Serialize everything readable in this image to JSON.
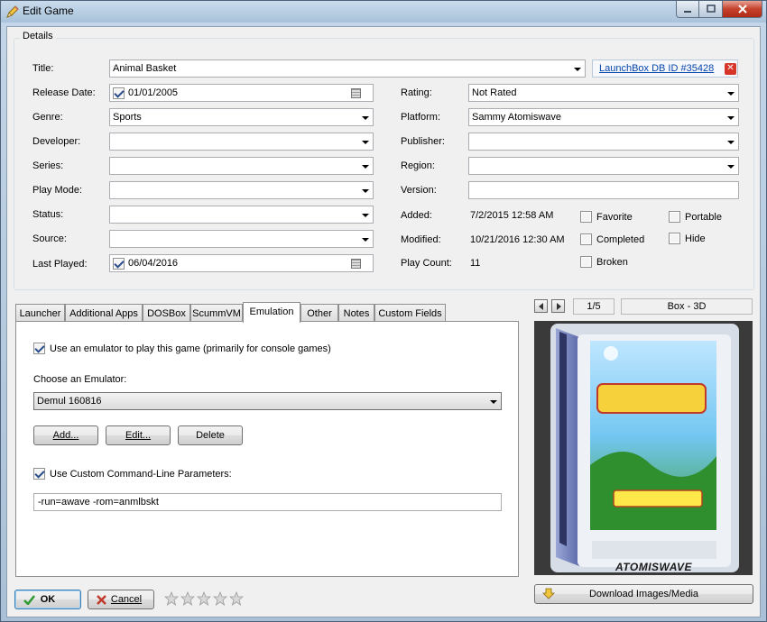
{
  "window": {
    "title": "Edit Game"
  },
  "details": {
    "legend": "Details",
    "labels": {
      "title": "Title:",
      "release_date": "Release Date:",
      "genre": "Genre:",
      "developer": "Developer:",
      "series": "Series:",
      "play_mode": "Play Mode:",
      "status": "Status:",
      "source": "Source:",
      "last_played": "Last Played:",
      "rating": "Rating:",
      "platform": "Platform:",
      "publisher": "Publisher:",
      "region": "Region:",
      "version": "Version:",
      "added": "Added:",
      "modified": "Modified:",
      "play_count": "Play Count:"
    },
    "values": {
      "title": "Animal Basket",
      "release_date": "01/01/2005",
      "genre": "Sports",
      "developer": "",
      "series": "",
      "play_mode": "",
      "status": "",
      "source": "",
      "last_played": "06/04/2016",
      "rating": "Not Rated",
      "platform": "Sammy Atomiswave",
      "publisher": "",
      "region": "",
      "version": "",
      "added": "7/2/2015 12:58 AM",
      "modified": "10/21/2016 12:30 AM",
      "play_count": "11"
    },
    "db_link": "LaunchBox DB ID #35428",
    "flags": {
      "favorite": "Favorite",
      "completed": "Completed",
      "broken": "Broken",
      "portable": "Portable",
      "hide": "Hide"
    }
  },
  "tabs": [
    "Launcher",
    "Additional Apps",
    "DOSBox",
    "ScummVM",
    "Emulation",
    "Other",
    "Notes",
    "Custom Fields"
  ],
  "active_tab": "Emulation",
  "emulation": {
    "use_emulator_label": "Use an emulator to play this game (primarily for console games)",
    "choose_label": "Choose an Emulator:",
    "emulator": "Demul 160816",
    "add_btn": "Add...",
    "edit_btn": "Edit...",
    "delete_btn": "Delete",
    "custom_cmd_label": "Use Custom Command-Line Parameters:",
    "cmd_params": "-run=awave -rom=anmlbskt"
  },
  "image_panel": {
    "counter": "1/5",
    "image_type": "Box - 3D",
    "box_logo": "ATOMISWAVE",
    "download_btn": "Download Images/Media"
  },
  "footer": {
    "ok": "OK",
    "cancel": "Cancel",
    "rating_stars": 0,
    "max_stars": 5
  },
  "colors": {
    "accent": "#3a6ea5",
    "link": "#0645ad",
    "clear": "#d7352a"
  }
}
